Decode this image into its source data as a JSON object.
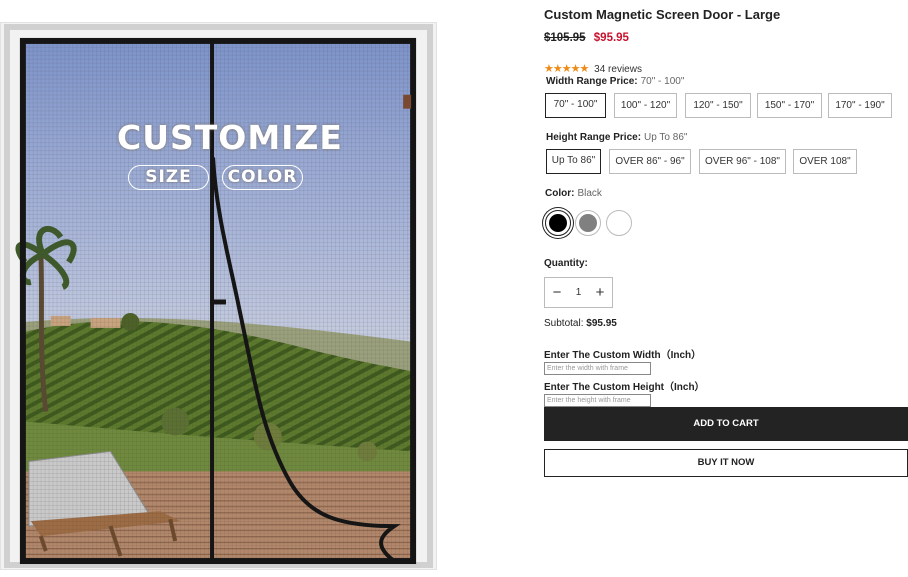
{
  "product": {
    "title": "Custom Magnetic Screen Door - Large",
    "price_old": "$105.95",
    "price_new": "$95.95",
    "rating": 5,
    "reviews": "34 reviews"
  },
  "image": {
    "promo_title": "CUSTOMIZE",
    "promo_size": "SIZE",
    "promo_color": "COLOR"
  },
  "width_range": {
    "label": "Width Range Price:",
    "selected": "70\" - 100\"",
    "options": [
      "70\" - 100\"",
      "100\" - 120\"",
      "120\" - 150\"",
      "150\" - 170\"",
      "170\" - 190\""
    ]
  },
  "height_range": {
    "label": "Height Range Price:",
    "selected": "Up To 86\"",
    "options": [
      "Up To 86\"",
      "OVER 86\" - 96\"",
      "OVER 96\" - 108\"",
      "OVER 108\""
    ]
  },
  "color": {
    "label": "Color:",
    "selected": "Black",
    "swatches": [
      {
        "name": "Black",
        "hex": "#000000"
      },
      {
        "name": "Gray",
        "hex": "#808080"
      },
      {
        "name": "White",
        "hex": "#ffffff"
      }
    ]
  },
  "quantity": {
    "label": "Quantity:",
    "value": "1",
    "minus": "−",
    "plus": "+"
  },
  "subtotal": {
    "label": "Subtotal:",
    "value": "$95.95"
  },
  "custom_width": {
    "label": "Enter The Custom Width（Inch）",
    "placeholder": "Enter the width with frame"
  },
  "custom_height": {
    "label": "Enter The Custom Height（Inch）",
    "placeholder": "Enter the height with frame"
  },
  "buttons": {
    "add_to_cart": "ADD TO CART",
    "buy_now": "BUY IT NOW"
  },
  "colors": {
    "price_sale": "#c8102e",
    "star": "#f08a15",
    "button_dark": "#232323"
  }
}
